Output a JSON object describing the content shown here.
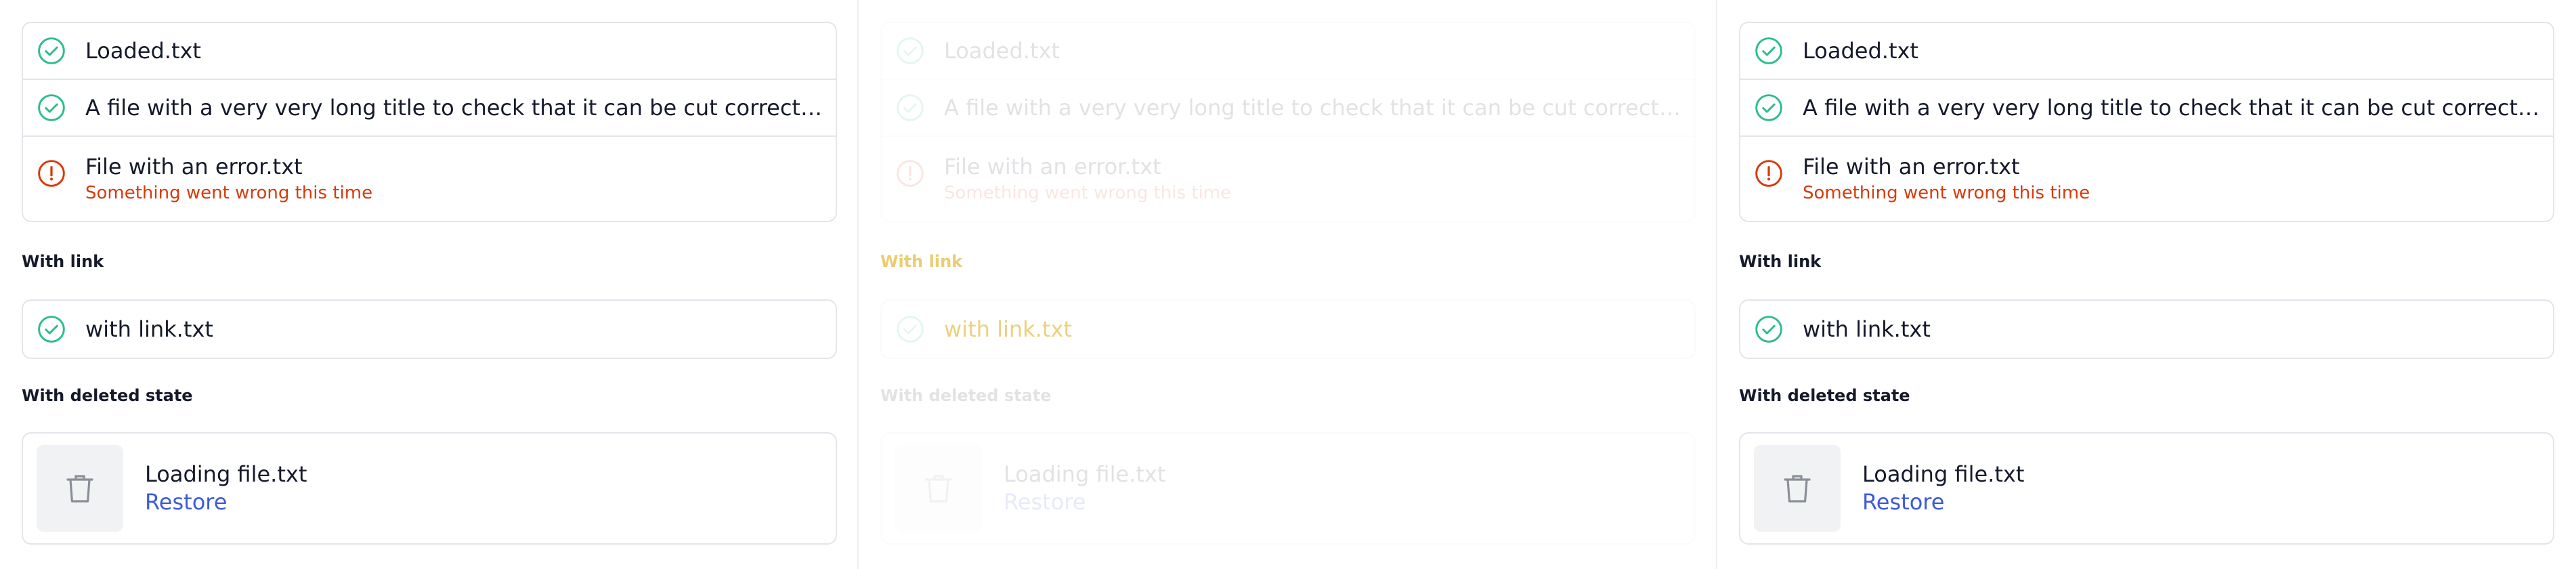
{
  "colors": {
    "success": "#2dbd8c",
    "error": "#d83a0b",
    "link": "#3d5bd9",
    "border": "#e3e5ea"
  },
  "panels": [
    {
      "files": [
        {
          "name": "Loaded.txt",
          "status": "success",
          "icon": "check-circle-icon"
        },
        {
          "name": "A file with a very very long title to check that it can be cut correctly.txt",
          "status": "success",
          "icon": "check-circle-icon"
        },
        {
          "name": "File with an error.txt",
          "status": "error",
          "icon": "alert-circle-icon",
          "error": "Something went wrong this time"
        }
      ],
      "link_section": {
        "label": "With link",
        "file": "with link.txt"
      },
      "deleted_section": {
        "label": "With deleted state",
        "file": "Loading file.txt",
        "restore": "Restore",
        "icon": "trash-icon"
      }
    },
    {
      "files": [
        {
          "name": "Loaded.txt",
          "status": "success",
          "icon": "check-circle-icon"
        },
        {
          "name": "A file with a very very long title to check that it can be cut correctly.txt",
          "status": "success",
          "icon": "check-circle-icon"
        },
        {
          "name": "File with an error.txt",
          "status": "error",
          "icon": "alert-circle-icon",
          "error": "Something went wrong this time"
        }
      ],
      "link_section": {
        "label": "With link",
        "file": "with link.txt"
      },
      "deleted_section": {
        "label": "With deleted state",
        "file": "Loading file.txt",
        "restore": "Restore",
        "icon": "trash-icon"
      }
    },
    {
      "files": [
        {
          "name": "Loaded.txt",
          "status": "success",
          "icon": "check-circle-icon"
        },
        {
          "name": "A file with a very very long title to check that it can be cut correctly.txt",
          "status": "success",
          "icon": "check-circle-icon"
        },
        {
          "name": "File with an error.txt",
          "status": "error",
          "icon": "alert-circle-icon",
          "error": "Something went wrong this time"
        }
      ],
      "link_section": {
        "label": "With link",
        "file": "with link.txt"
      },
      "deleted_section": {
        "label": "With deleted state",
        "file": "Loading file.txt",
        "restore": "Restore",
        "icon": "trash-icon"
      }
    }
  ]
}
